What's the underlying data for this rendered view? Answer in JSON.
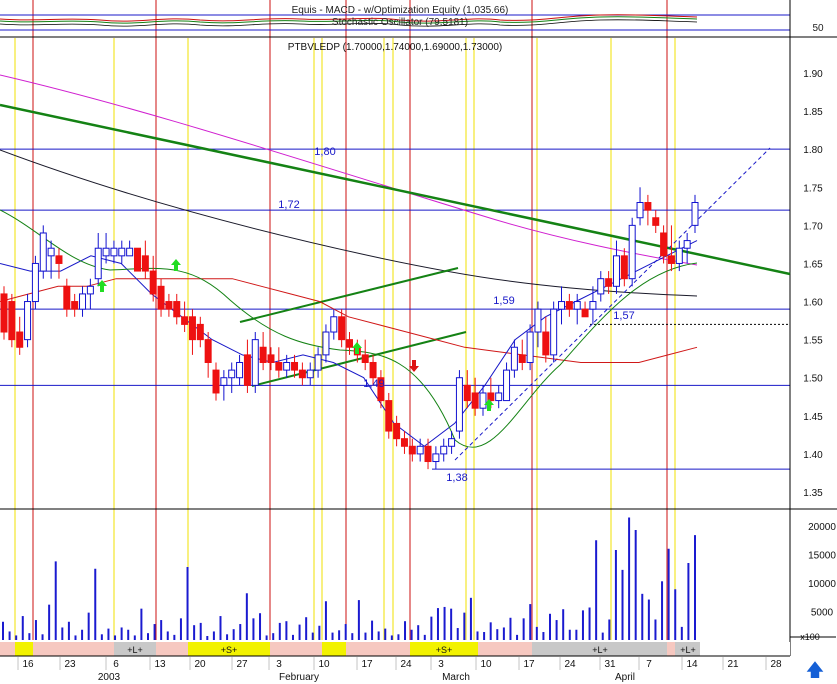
{
  "chart_data": {
    "type": "candlestick",
    "header": {
      "equity_label": "Equis - MACD - w/Optimization Equity (1,035.66)",
      "stochastic_label": "Stochastic Oscillator (79.5181)",
      "price_label": "PTBVLEDP (1.70000,1.74000,1.69000,1.73000)",
      "stochastic_tick": "50"
    },
    "price_axis": {
      "ticks": [
        "1.90",
        "1.85",
        "1.80",
        "1.75",
        "1.70",
        "1.65",
        "1.60",
        "1.55",
        "1.50",
        "1.45",
        "1.40",
        "1.35"
      ],
      "ylim": [
        1.33,
        1.955
      ]
    },
    "volume_axis": {
      "ticks": [
        "20000",
        "15000",
        "10000",
        "5000"
      ],
      "ylim": [
        0,
        23500
      ],
      "unit_label": "x100"
    },
    "x_axis": {
      "day_labels": [
        "16",
        "23",
        "6",
        "13",
        "20",
        "27",
        "3",
        "10",
        "17",
        "24",
        "3",
        "10",
        "17",
        "24",
        "31",
        "7",
        "14",
        "21",
        "28"
      ],
      "month_labels": [
        "2003",
        "February",
        "March",
        "April"
      ],
      "signal_labels": [
        "+L+",
        "+S+",
        "+S+",
        "+L+",
        "+L+"
      ]
    },
    "annotations": [
      "1,80",
      "1,72",
      "1,59",
      "1,57",
      "1,49",
      "1,38"
    ],
    "candles": [
      {
        "o": 1.61,
        "h": 1.62,
        "l": 1.55,
        "c": 1.56,
        "up": false
      },
      {
        "o": 1.6,
        "h": 1.61,
        "l": 1.54,
        "c": 1.55,
        "up": false
      },
      {
        "o": 1.56,
        "h": 1.58,
        "l": 1.53,
        "c": 1.54,
        "up": false
      },
      {
        "o": 1.55,
        "h": 1.61,
        "l": 1.54,
        "c": 1.6,
        "up": true
      },
      {
        "o": 1.6,
        "h": 1.66,
        "l": 1.59,
        "c": 1.65,
        "up": true
      },
      {
        "o": 1.64,
        "h": 1.7,
        "l": 1.63,
        "c": 1.69,
        "up": true
      },
      {
        "o": 1.66,
        "h": 1.68,
        "l": 1.63,
        "c": 1.67,
        "up": true
      },
      {
        "o": 1.66,
        "h": 1.67,
        "l": 1.63,
        "c": 1.65,
        "up": false
      },
      {
        "o": 1.62,
        "h": 1.63,
        "l": 1.58,
        "c": 1.59,
        "up": false
      },
      {
        "o": 1.6,
        "h": 1.61,
        "l": 1.58,
        "c": 1.59,
        "up": false
      },
      {
        "o": 1.59,
        "h": 1.62,
        "l": 1.58,
        "c": 1.61,
        "up": true
      },
      {
        "o": 1.61,
        "h": 1.63,
        "l": 1.59,
        "c": 1.62,
        "up": true
      },
      {
        "o": 1.63,
        "h": 1.69,
        "l": 1.62,
        "c": 1.67,
        "up": true
      },
      {
        "o": 1.66,
        "h": 1.69,
        "l": 1.65,
        "c": 1.67,
        "up": true
      },
      {
        "o": 1.67,
        "h": 1.68,
        "l": 1.65,
        "c": 1.66,
        "up": true
      },
      {
        "o": 1.66,
        "h": 1.68,
        "l": 1.65,
        "c": 1.67,
        "up": true
      },
      {
        "o": 1.67,
        "h": 1.68,
        "l": 1.66,
        "c": 1.66,
        "up": true
      },
      {
        "o": 1.67,
        "h": 1.67,
        "l": 1.64,
        "c": 1.64,
        "up": false
      },
      {
        "o": 1.66,
        "h": 1.68,
        "l": 1.63,
        "c": 1.64,
        "up": false
      },
      {
        "o": 1.64,
        "h": 1.66,
        "l": 1.6,
        "c": 1.61,
        "up": false
      },
      {
        "o": 1.62,
        "h": 1.63,
        "l": 1.58,
        "c": 1.59,
        "up": false
      },
      {
        "o": 1.6,
        "h": 1.61,
        "l": 1.58,
        "c": 1.59,
        "up": false
      },
      {
        "o": 1.6,
        "h": 1.61,
        "l": 1.57,
        "c": 1.58,
        "up": false
      },
      {
        "o": 1.58,
        "h": 1.6,
        "l": 1.56,
        "c": 1.57,
        "up": false
      },
      {
        "o": 1.58,
        "h": 1.59,
        "l": 1.53,
        "c": 1.55,
        "up": false
      },
      {
        "o": 1.57,
        "h": 1.58,
        "l": 1.54,
        "c": 1.55,
        "up": false
      },
      {
        "o": 1.55,
        "h": 1.56,
        "l": 1.5,
        "c": 1.52,
        "up": false
      },
      {
        "o": 1.51,
        "h": 1.52,
        "l": 1.47,
        "c": 1.48,
        "up": false
      },
      {
        "o": 1.49,
        "h": 1.51,
        "l": 1.47,
        "c": 1.5,
        "up": true
      },
      {
        "o": 1.5,
        "h": 1.52,
        "l": 1.48,
        "c": 1.51,
        "up": true
      },
      {
        "o": 1.5,
        "h": 1.53,
        "l": 1.49,
        "c": 1.52,
        "up": true
      },
      {
        "o": 1.53,
        "h": 1.55,
        "l": 1.48,
        "c": 1.49,
        "up": false
      },
      {
        "o": 1.49,
        "h": 1.56,
        "l": 1.48,
        "c": 1.55,
        "up": true
      },
      {
        "o": 1.54,
        "h": 1.56,
        "l": 1.51,
        "c": 1.52,
        "up": false
      },
      {
        "o": 1.53,
        "h": 1.54,
        "l": 1.51,
        "c": 1.52,
        "up": false
      },
      {
        "o": 1.52,
        "h": 1.54,
        "l": 1.5,
        "c": 1.51,
        "up": false
      },
      {
        "o": 1.51,
        "h": 1.53,
        "l": 1.5,
        "c": 1.52,
        "up": true
      },
      {
        "o": 1.52,
        "h": 1.53,
        "l": 1.5,
        "c": 1.51,
        "up": false
      },
      {
        "o": 1.51,
        "h": 1.52,
        "l": 1.49,
        "c": 1.5,
        "up": false
      },
      {
        "o": 1.5,
        "h": 1.52,
        "l": 1.49,
        "c": 1.51,
        "up": true
      },
      {
        "o": 1.51,
        "h": 1.54,
        "l": 1.5,
        "c": 1.53,
        "up": true
      },
      {
        "o": 1.53,
        "h": 1.57,
        "l": 1.52,
        "c": 1.56,
        "up": true
      },
      {
        "o": 1.56,
        "h": 1.59,
        "l": 1.55,
        "c": 1.58,
        "up": true
      },
      {
        "o": 1.58,
        "h": 1.59,
        "l": 1.54,
        "c": 1.55,
        "up": false
      },
      {
        "o": 1.55,
        "h": 1.56,
        "l": 1.53,
        "c": 1.54,
        "up": false
      },
      {
        "o": 1.54,
        "h": 1.55,
        "l": 1.52,
        "c": 1.53,
        "up": false
      },
      {
        "o": 1.53,
        "h": 1.55,
        "l": 1.51,
        "c": 1.52,
        "up": false
      },
      {
        "o": 1.52,
        "h": 1.53,
        "l": 1.49,
        "c": 1.5,
        "up": false
      },
      {
        "o": 1.5,
        "h": 1.51,
        "l": 1.46,
        "c": 1.47,
        "up": false
      },
      {
        "o": 1.47,
        "h": 1.48,
        "l": 1.42,
        "c": 1.43,
        "up": false
      },
      {
        "o": 1.44,
        "h": 1.45,
        "l": 1.41,
        "c": 1.42,
        "up": false
      },
      {
        "o": 1.42,
        "h": 1.43,
        "l": 1.4,
        "c": 1.41,
        "up": false
      },
      {
        "o": 1.41,
        "h": 1.42,
        "l": 1.39,
        "c": 1.4,
        "up": false
      },
      {
        "o": 1.4,
        "h": 1.42,
        "l": 1.39,
        "c": 1.41,
        "up": true
      },
      {
        "o": 1.41,
        "h": 1.42,
        "l": 1.38,
        "c": 1.39,
        "up": false
      },
      {
        "o": 1.39,
        "h": 1.41,
        "l": 1.38,
        "c": 1.4,
        "up": true
      },
      {
        "o": 1.4,
        "h": 1.42,
        "l": 1.39,
        "c": 1.41,
        "up": true
      },
      {
        "o": 1.41,
        "h": 1.43,
        "l": 1.4,
        "c": 1.42,
        "up": true
      },
      {
        "o": 1.43,
        "h": 1.51,
        "l": 1.42,
        "c": 1.5,
        "up": true
      },
      {
        "o": 1.49,
        "h": 1.51,
        "l": 1.46,
        "c": 1.47,
        "up": false
      },
      {
        "o": 1.48,
        "h": 1.5,
        "l": 1.45,
        "c": 1.46,
        "up": false
      },
      {
        "o": 1.46,
        "h": 1.49,
        "l": 1.45,
        "c": 1.48,
        "up": true
      },
      {
        "o": 1.48,
        "h": 1.5,
        "l": 1.46,
        "c": 1.47,
        "up": false
      },
      {
        "o": 1.47,
        "h": 1.49,
        "l": 1.46,
        "c": 1.48,
        "up": true
      },
      {
        "o": 1.47,
        "h": 1.52,
        "l": 1.47,
        "c": 1.51,
        "up": true
      },
      {
        "o": 1.51,
        "h": 1.55,
        "l": 1.5,
        "c": 1.54,
        "up": true
      },
      {
        "o": 1.53,
        "h": 1.55,
        "l": 1.51,
        "c": 1.52,
        "up": false
      },
      {
        "o": 1.52,
        "h": 1.57,
        "l": 1.51,
        "c": 1.56,
        "up": true
      },
      {
        "o": 1.56,
        "h": 1.6,
        "l": 1.54,
        "c": 1.59,
        "up": true
      },
      {
        "o": 1.56,
        "h": 1.58,
        "l": 1.52,
        "c": 1.53,
        "up": false
      },
      {
        "o": 1.53,
        "h": 1.6,
        "l": 1.52,
        "c": 1.59,
        "up": true
      },
      {
        "o": 1.59,
        "h": 1.62,
        "l": 1.57,
        "c": 1.6,
        "up": true
      },
      {
        "o": 1.6,
        "h": 1.61,
        "l": 1.58,
        "c": 1.59,
        "up": false
      },
      {
        "o": 1.59,
        "h": 1.61,
        "l": 1.57,
        "c": 1.6,
        "up": true
      },
      {
        "o": 1.59,
        "h": 1.6,
        "l": 1.58,
        "c": 1.58,
        "up": false
      },
      {
        "o": 1.59,
        "h": 1.62,
        "l": 1.57,
        "c": 1.6,
        "up": true
      },
      {
        "o": 1.61,
        "h": 1.64,
        "l": 1.6,
        "c": 1.63,
        "up": true
      },
      {
        "o": 1.63,
        "h": 1.64,
        "l": 1.61,
        "c": 1.62,
        "up": false
      },
      {
        "o": 1.62,
        "h": 1.68,
        "l": 1.61,
        "c": 1.66,
        "up": true
      },
      {
        "o": 1.66,
        "h": 1.67,
        "l": 1.62,
        "c": 1.63,
        "up": false
      },
      {
        "o": 1.63,
        "h": 1.71,
        "l": 1.62,
        "c": 1.7,
        "up": true
      },
      {
        "o": 1.71,
        "h": 1.75,
        "l": 1.7,
        "c": 1.73,
        "up": true
      },
      {
        "o": 1.73,
        "h": 1.74,
        "l": 1.7,
        "c": 1.72,
        "up": false
      },
      {
        "o": 1.71,
        "h": 1.72,
        "l": 1.69,
        "c": 1.7,
        "up": false
      },
      {
        "o": 1.69,
        "h": 1.7,
        "l": 1.65,
        "c": 1.66,
        "up": false
      },
      {
        "o": 1.66,
        "h": 1.7,
        "l": 1.64,
        "c": 1.65,
        "up": false
      },
      {
        "o": 1.65,
        "h": 1.68,
        "l": 1.64,
        "c": 1.67,
        "up": true
      },
      {
        "o": 1.67,
        "h": 1.69,
        "l": 1.65,
        "c": 1.68,
        "up": true
      },
      {
        "o": 1.7,
        "h": 1.74,
        "l": 1.69,
        "c": 1.73,
        "up": true
      }
    ],
    "volume": [
      3200,
      1500,
      800,
      4200,
      1200,
      3500,
      1000,
      6200,
      13800,
      2200,
      3200,
      800,
      1800,
      4800,
      12500,
      1000,
      2000,
      800,
      2200,
      1800,
      800,
      5500,
      1200,
      2800,
      3500,
      1500,
      900,
      3800,
      12800,
      2600,
      3000,
      700,
      1500,
      4200,
      1000,
      1900,
      2800,
      8200,
      3800,
      4700,
      800,
      1200,
      3000,
      3300,
      900,
      2700,
      4000,
      1300,
      2500,
      6800,
      1300,
      1700,
      2800,
      1200,
      7000,
      1300,
      3400,
      1500,
      2000,
      800,
      1000,
      3300,
      1800,
      2600,
      900,
      4100,
      5600,
      5800,
      5500,
      2100,
      4800,
      7400,
      1500,
      1400,
      3100,
      1900,
      2200,
      3900,
      900,
      3800,
      6300,
      2300,
      1400,
      4600,
      3500,
      5400,
      1800,
      1800,
      5200,
      5700,
      17500,
      1300,
      3600,
      15800,
      12300,
      21500,
      19300,
      8100,
      7100,
      3600,
      10300,
      16000,
      8900,
      2300,
      13500,
      18400
    ],
    "overlays": {
      "red_ma": [
        1.6,
        1.61,
        1.62,
        1.62,
        1.63,
        1.63,
        1.63,
        1.63,
        1.63,
        1.62,
        1.61,
        1.6,
        1.58,
        1.57,
        1.56,
        1.55,
        1.54,
        1.535,
        1.53,
        1.525,
        1.52,
        1.52,
        1.52,
        1.53,
        1.54
      ],
      "blue_ma": [
        1.65,
        1.64,
        1.64,
        1.66,
        1.65,
        1.61,
        1.58,
        1.55,
        1.53,
        1.52,
        1.53,
        1.52,
        1.5,
        1.44,
        1.41,
        1.44,
        1.49,
        1.55,
        1.58,
        1.6,
        1.62,
        1.64,
        1.66,
        1.68
      ]
    },
    "colors": {
      "up_candle": "#1212d0",
      "down_candle": "#ee1111",
      "price_line_blue": "#1818c8",
      "grid_red": "#cc1010",
      "grid_yellow": "#f2e200",
      "trend_green": "#148214",
      "magenta": "#d020d0",
      "signal_long": "#c8c8c8",
      "signal_short": "#f2f200",
      "signal_neutral": "#f6c8c0"
    }
  }
}
